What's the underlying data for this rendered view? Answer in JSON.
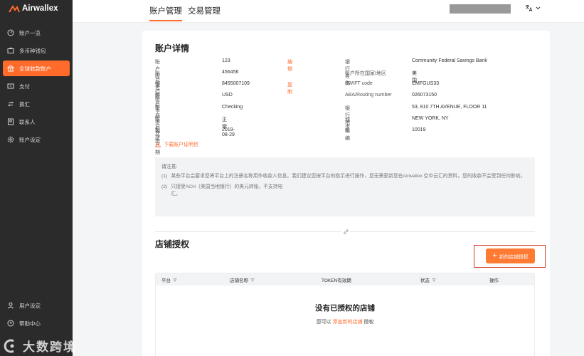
{
  "app": {
    "brand": "Airwallex"
  },
  "sidebar": {
    "items": [
      {
        "label": "账户一览",
        "icon": "dashboard-icon"
      },
      {
        "label": "多币种钱包",
        "icon": "wallet-icon"
      },
      {
        "label": "全球收款账户",
        "icon": "bank-icon",
        "active": true
      },
      {
        "label": "支付",
        "icon": "payment-icon"
      },
      {
        "label": "换汇",
        "icon": "exchange-icon"
      },
      {
        "label": "联系人",
        "icon": "contacts-icon"
      },
      {
        "label": "账户设定",
        "icon": "settings-icon"
      }
    ],
    "bottom_items": [
      {
        "label": "用户设定",
        "icon": "user-icon"
      },
      {
        "label": "帮助中心",
        "icon": "help-icon"
      }
    ]
  },
  "topbar": {
    "tabs": [
      {
        "label": "账户管理",
        "active": true
      },
      {
        "label": "交易管理"
      }
    ]
  },
  "details": {
    "title": "账户详情",
    "left": [
      {
        "label": "账户昵称",
        "value": "123",
        "action": "编辑"
      },
      {
        "label": "账户名称",
        "value": "456456"
      },
      {
        "label": "银行账号",
        "value": "8455007109",
        "action": "复制"
      },
      {
        "label": "账户币种",
        "value": "USD"
      },
      {
        "label": "账户类型",
        "value": "Checking"
      },
      {
        "label": "账户状态",
        "value": "正常"
      },
      {
        "label": "创建日期",
        "value": "2019-08-29"
      }
    ],
    "right": [
      {
        "label": "银行名称",
        "value": "Community Federal Savings Bank"
      },
      {
        "label": "账户所在国家/地区",
        "value": "美国"
      },
      {
        "label": "SWIFT code",
        "value": "CMFGUS33"
      },
      {
        "label": "ABA/Routing number",
        "value": "026073150"
      },
      {
        "label": "银行地址",
        "value": "53, 810 7TH AVENUE, FLOOR 11"
      },
      {
        "label": "城市",
        "value": "NEW YORK, NY"
      },
      {
        "label": "邮编",
        "value": "10019"
      }
    ],
    "download_label": "下载账户证明信"
  },
  "notice": {
    "title": "请注意:",
    "items": [
      {
        "num": "(1)",
        "text": "某些平台会要求您将平台上的注册名称用作收款人信息。我们建议您按平台的指示进行操作，您无需更新您在Airwallex 空中云汇的资料，您的收款不会受到任何影响。"
      },
      {
        "num": "(2)",
        "text": "只接受ACH（美国当地银行）的美元转账。不支持电汇。"
      }
    ]
  },
  "stores": {
    "title": "店铺授权",
    "new_button": "新的店铺授权",
    "columns": [
      {
        "label": "平台",
        "filter": true
      },
      {
        "label": "店铺名称",
        "filter": true
      },
      {
        "label": "TOKEN有效期",
        "filter": false
      },
      {
        "label": "状态",
        "filter": true
      },
      {
        "label": "操作",
        "filter": false
      }
    ],
    "empty_title": "没有已授权的店铺",
    "empty_prefix": "您可以",
    "empty_link": "添加新的店铺",
    "empty_suffix": "授权"
  },
  "watermark": {
    "text": "大数跨境"
  },
  "colors": {
    "accent": "#ff6b2b",
    "sidebar": "#2b2b2b",
    "highlight_frame": "#d43c2c"
  }
}
